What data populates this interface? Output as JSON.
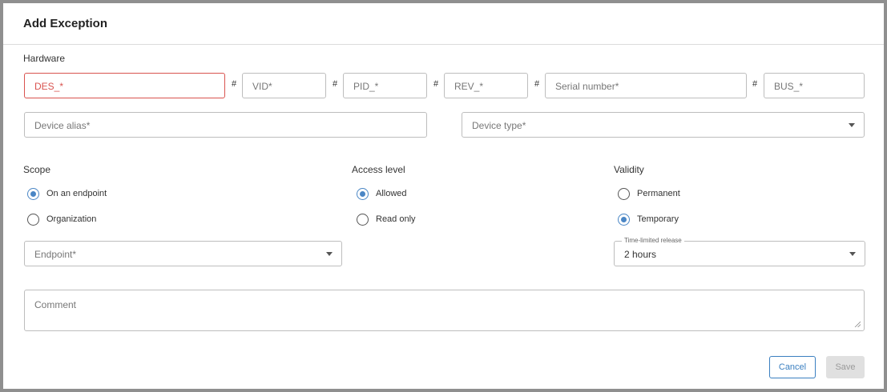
{
  "dialog": {
    "title": "Add Exception",
    "cancel_label": "Cancel",
    "save_label": "Save"
  },
  "hardware": {
    "label": "Hardware",
    "separator": "#",
    "des_placeholder": "DES_*",
    "vid_placeholder": "VID*",
    "pid_placeholder": "PID_*",
    "rev_placeholder": "REV_*",
    "serial_placeholder": "Serial number*",
    "bus_placeholder": "BUS_*",
    "alias_placeholder": "Device alias*",
    "type_placeholder": "Device type*"
  },
  "scope": {
    "label": "Scope",
    "options": [
      "On an endpoint",
      "Organization"
    ],
    "selected": "On an endpoint",
    "endpoint_placeholder": "Endpoint*"
  },
  "access": {
    "label": "Access level",
    "options": [
      "Allowed",
      "Read only"
    ],
    "selected": "Allowed"
  },
  "validity": {
    "label": "Validity",
    "options": [
      "Permanent",
      "Temporary"
    ],
    "selected": "Temporary",
    "time_label": "Time-limited release",
    "time_value": "2 hours"
  },
  "comment": {
    "placeholder": "Comment"
  },
  "colors": {
    "accent": "#4a86c5",
    "error": "#d9534f"
  }
}
